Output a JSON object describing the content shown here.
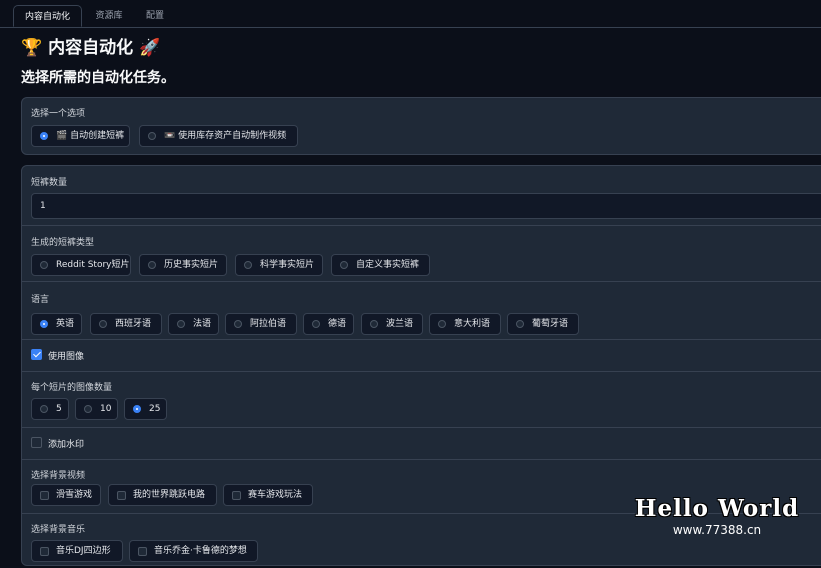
{
  "tabs": [
    {
      "label": "内容自动化"
    },
    {
      "label": "资源库"
    },
    {
      "label": "配置"
    }
  ],
  "title": "🏆 内容自动化 🚀",
  "subtitle": "选择所需的自动化任务。",
  "mode": {
    "label": "选择一个选项",
    "options": [
      {
        "label": "🎬 自动创建短裤",
        "selected": true
      },
      {
        "label": "📼 使用库存资产自动制作视频",
        "selected": false
      }
    ]
  },
  "count": {
    "label": "短裤数量",
    "value": "1"
  },
  "short_type": {
    "label": "生成的短裤类型",
    "options": [
      {
        "label": "Reddit Story短片"
      },
      {
        "label": "历史事实短片"
      },
      {
        "label": "科学事实短片"
      },
      {
        "label": "自定义事实短裤"
      }
    ]
  },
  "language": {
    "label": "语言",
    "options": [
      {
        "label": "英语",
        "selected": true
      },
      {
        "label": "西班牙语"
      },
      {
        "label": "法语"
      },
      {
        "label": "阿拉伯语"
      },
      {
        "label": "德语"
      },
      {
        "label": "波兰语"
      },
      {
        "label": "意大利语"
      },
      {
        "label": "葡萄牙语"
      }
    ]
  },
  "use_images": {
    "label": "使用图像",
    "checked": true
  },
  "images_per_short": {
    "label": "每个短片的图像数量",
    "options": [
      {
        "label": "5"
      },
      {
        "label": "10"
      },
      {
        "label": "25",
        "selected": true
      }
    ]
  },
  "watermark_option": {
    "label": "添加水印",
    "checked": false
  },
  "bg_video": {
    "label": "选择背景视频",
    "options": [
      {
        "label": "滑雪游戏"
      },
      {
        "label": "我的世界跳跃电路"
      },
      {
        "label": "赛车游戏玩法"
      }
    ]
  },
  "bg_music": {
    "label": "选择背景音乐",
    "options": [
      {
        "label": "音乐DJ四边形"
      },
      {
        "label": "音乐乔金·卡鲁德的梦想"
      }
    ]
  },
  "site_watermark": {
    "line1": "Hello World",
    "line2": "www.77388.cn"
  },
  "colors": {
    "background": "#0b0f19",
    "panel": "#1f2937",
    "accent": "#3b82f6"
  }
}
